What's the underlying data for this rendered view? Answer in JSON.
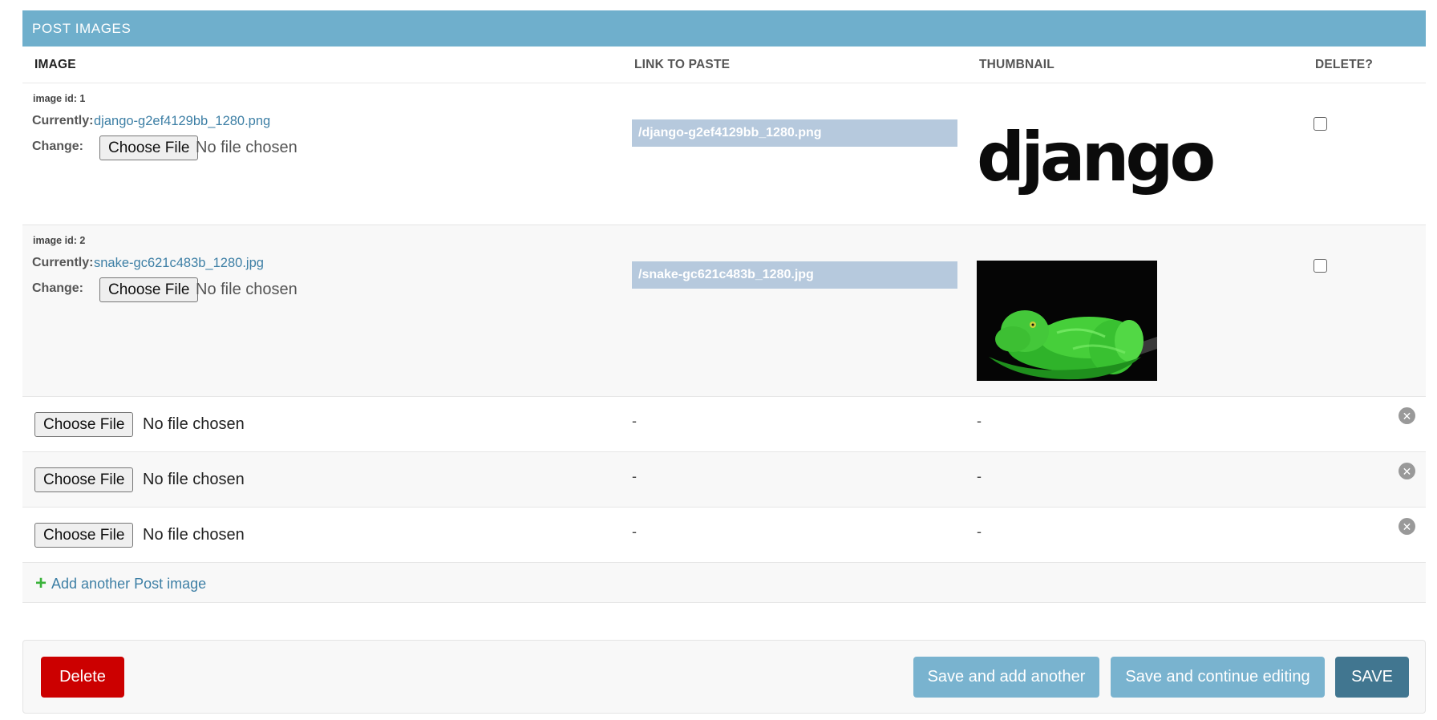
{
  "inline": {
    "caption": "POST IMAGES",
    "headers": {
      "image": "IMAGE",
      "link": "LINK TO PASTE",
      "thumbnail": "THUMBNAIL",
      "delete": "DELETE?"
    },
    "rows": [
      {
        "id_label": "image id: 1",
        "currently_label": "Currently:",
        "currently_link": "django-g2ef4129bb_1280.png",
        "change_label": "Change:",
        "choose_file": "Choose File",
        "no_file": "No file chosen",
        "link_value": "/django-g2ef4129bb_1280.png",
        "thumbnail_text": "django"
      },
      {
        "id_label": "image id: 2",
        "currently_label": "Currently:",
        "currently_link": "snake-gc621c483b_1280.jpg",
        "change_label": "Change:",
        "choose_file": "Choose File",
        "no_file": "No file chosen",
        "link_value": "/snake-gc621c483b_1280.jpg"
      }
    ],
    "empty_rows": [
      {
        "choose_file": "Choose File",
        "no_file": "No file chosen",
        "link": "-",
        "thumbnail": "-"
      },
      {
        "choose_file": "Choose File",
        "no_file": "No file chosen",
        "link": "-",
        "thumbnail": "-"
      },
      {
        "choose_file": "Choose File",
        "no_file": "No file chosen",
        "link": "-",
        "thumbnail": "-"
      }
    ],
    "add_another": "Add another Post image"
  },
  "submit": {
    "delete": "Delete",
    "save_add_another": "Save and add another",
    "save_continue": "Save and continue editing",
    "save": "SAVE"
  },
  "icons": {
    "remove": "remove-circle-icon",
    "add": "plus-icon"
  },
  "colors": {
    "caption_bg": "#6fafcc",
    "link_bg": "#b6c9dd",
    "delete_btn": "#cc0000",
    "save_btn": "#417690",
    "secondary_btn": "#79b3cf",
    "link_text": "#3d7fa5"
  }
}
